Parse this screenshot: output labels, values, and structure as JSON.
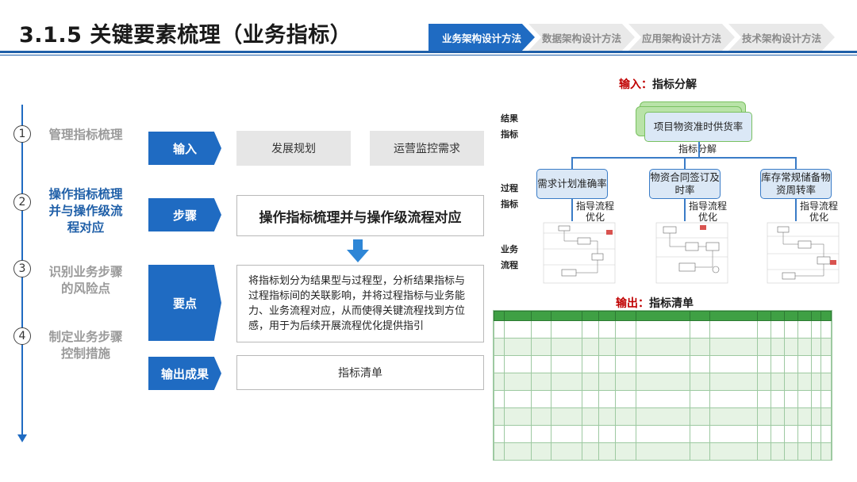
{
  "header": {
    "title": "3.1.5 关键要素梳理（业务指标）",
    "nav_tabs": [
      {
        "label": "业务架构设计方法",
        "active": true
      },
      {
        "label": "数据架构设计方法",
        "active": false
      },
      {
        "label": "应用架构设计方法",
        "active": false
      },
      {
        "label": "技术架构设计方法",
        "active": false
      }
    ]
  },
  "steps": [
    {
      "num": "1",
      "text": "管理指标梳理"
    },
    {
      "num": "2",
      "text": "操作指标梳理并与操作级流程对应"
    },
    {
      "num": "3",
      "text": "识别业务步骤的风险点"
    },
    {
      "num": "4",
      "text": "制定业务步骤控制措施"
    }
  ],
  "rows": {
    "input": {
      "label": "输入",
      "items": [
        "发展规划",
        "运营监控需求"
      ]
    },
    "step": {
      "label": "步骤",
      "content": "操作指标梳理并与操作级流程对应"
    },
    "key": {
      "label": "要点",
      "content": "将指标划分为结果型与过程型，分析结果指标与过程指标间的关联影响，并将过程指标与业务能力、业务流程对应，从而使得关键流程找到方位感，用于为后续开展流程优化提供指引"
    },
    "output": {
      "label": "输出成果",
      "content": "指标清单"
    }
  },
  "diagram": {
    "input_title_prefix": "输入：",
    "input_title": "指标分解",
    "side_labels": [
      "结果指标",
      "过程指标",
      "业务流程"
    ],
    "result_node": "项目物资准时供货率",
    "decompose_label": "指标分解",
    "process_nodes": [
      "需求计划准确率",
      "物资合同签订及时率",
      "库存常规储备物资周转率"
    ],
    "guide_label": "指导流程优化",
    "output_title_prefix": "输出：",
    "output_title": "指标清单"
  },
  "colors": {
    "brand_blue": "#1f6bc2",
    "table_green": "#3fa044",
    "title_red": "#c00000",
    "node_fill": "#dbe8f6"
  }
}
